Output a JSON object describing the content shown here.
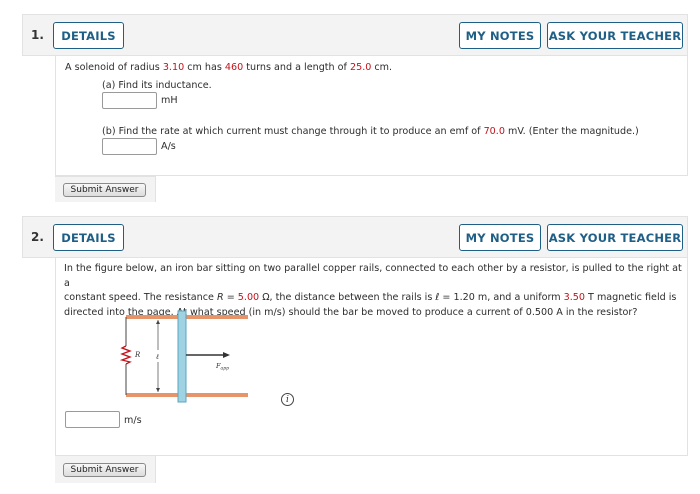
{
  "buttons": {
    "details": "DETAILS",
    "my_notes": "MY NOTES",
    "ask": "ASK YOUR TEACHER",
    "submit": "Submit Answer"
  },
  "q1": {
    "number": "1.",
    "intro_pre": "A solenoid of radius ",
    "radius": "3.10",
    "intro_mid1": " cm has ",
    "turns": "460",
    "intro_mid2": " turns and a length of ",
    "length": "25.0",
    "intro_post": " cm.",
    "part_a": "(a) Find its inductance.",
    "part_a_value": "",
    "part_a_unit": "mH",
    "part_b_pre": "(b) Find the rate at which current must change through it to produce an emf of ",
    "emf": "70.0",
    "part_b_post": " mV. (Enter the magnitude.)",
    "part_b_value": "",
    "part_b_unit": "A/s"
  },
  "q2": {
    "number": "2.",
    "line1": "In the figure below, an iron bar sitting on two parallel copper rails, connected to each other by a resistor, is pulled to the right at a",
    "line2_pre": "constant speed. The resistance ",
    "line2_R": "R",
    "line2_eq": " = ",
    "resistance": "5.00",
    "line2_mid": " Ω, the distance between the rails is ℓ = 1.20 m, and a uniform ",
    "field": "3.50",
    "line2_post": " T magnetic field is",
    "line3": "directed into the page. At what speed (in m/s) should the bar be moved to produce a current of 0.500 A in the resistor?",
    "answer_value": "",
    "answer_unit": "m/s",
    "figure": {
      "resistor_label": "R",
      "length_label": "ℓ",
      "force_label": "F",
      "force_sub": "app"
    },
    "info_symbol": "i"
  }
}
